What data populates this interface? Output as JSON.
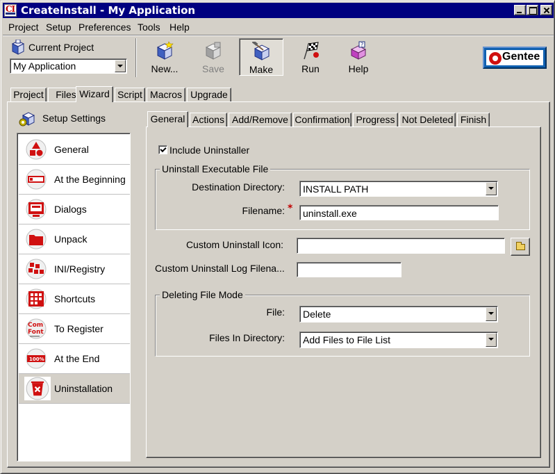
{
  "window": {
    "title": "CreateInstall - My Application",
    "icon_text": "CI"
  },
  "menu": [
    "Project",
    "Setup",
    "Preferences",
    "Tools",
    "Help"
  ],
  "current_project": {
    "label": "Current Project",
    "value": "My Application"
  },
  "toolbar": {
    "new": "New...",
    "save": "Save",
    "make": "Make",
    "run": "Run",
    "help": "Help"
  },
  "brand": "Gentee",
  "main_tabs": [
    "Project",
    "Files",
    "Wizard",
    "Script",
    "Macros",
    "Upgrade"
  ],
  "main_tab_active": "Wizard",
  "setup_settings_label": "Setup Settings",
  "nav_items": [
    {
      "label": "General",
      "icon": "general-shapes-icon"
    },
    {
      "label": "At the Beginning",
      "icon": "progress-start-icon"
    },
    {
      "label": "Dialogs",
      "icon": "dialog-monitor-icon"
    },
    {
      "label": "Unpack",
      "icon": "folder-icon"
    },
    {
      "label": "INI/Registry",
      "icon": "registry-cubes-icon"
    },
    {
      "label": "Shortcuts",
      "icon": "shortcuts-grid-icon"
    },
    {
      "label": "To Register",
      "icon": "com-font-icon"
    },
    {
      "label": "At the End",
      "icon": "progress-complete-icon"
    },
    {
      "label": "Uninstallation",
      "icon": "recycle-bin-icon"
    }
  ],
  "nav_selected": "Uninstallation",
  "nav_icon_texts": {
    "com": "Com",
    "font": "Font",
    "percent_full": "100%"
  },
  "sub_tabs": [
    "General",
    "Actions",
    "Add/Remove",
    "Confirmation",
    "Progress",
    "Not Deleted",
    "Finish"
  ],
  "sub_tab_active": "General",
  "form": {
    "include_uninstaller": {
      "label": "Include Uninstaller",
      "checked": true
    },
    "exe_group": {
      "title": "Uninstall Executable File",
      "dest_label": "Destination Directory:",
      "dest_value": "INSTALL PATH",
      "filename_label": "Filename:",
      "filename_value": "uninstall.exe",
      "required_mark": "*"
    },
    "custom_icon_label": "Custom Uninstall Icon:",
    "custom_icon_value": "",
    "custom_log_label": "Custom Uninstall Log Filena...",
    "custom_log_value": "",
    "delete_group": {
      "title": "Deleting File Mode",
      "file_label": "File:",
      "file_value": "Delete",
      "dir_label": "Files In Directory:",
      "dir_value": "Add Files to File List"
    }
  },
  "colors": {
    "titlebar": "#000080",
    "face": "#d4d0c8",
    "accent_red": "#d01010"
  }
}
